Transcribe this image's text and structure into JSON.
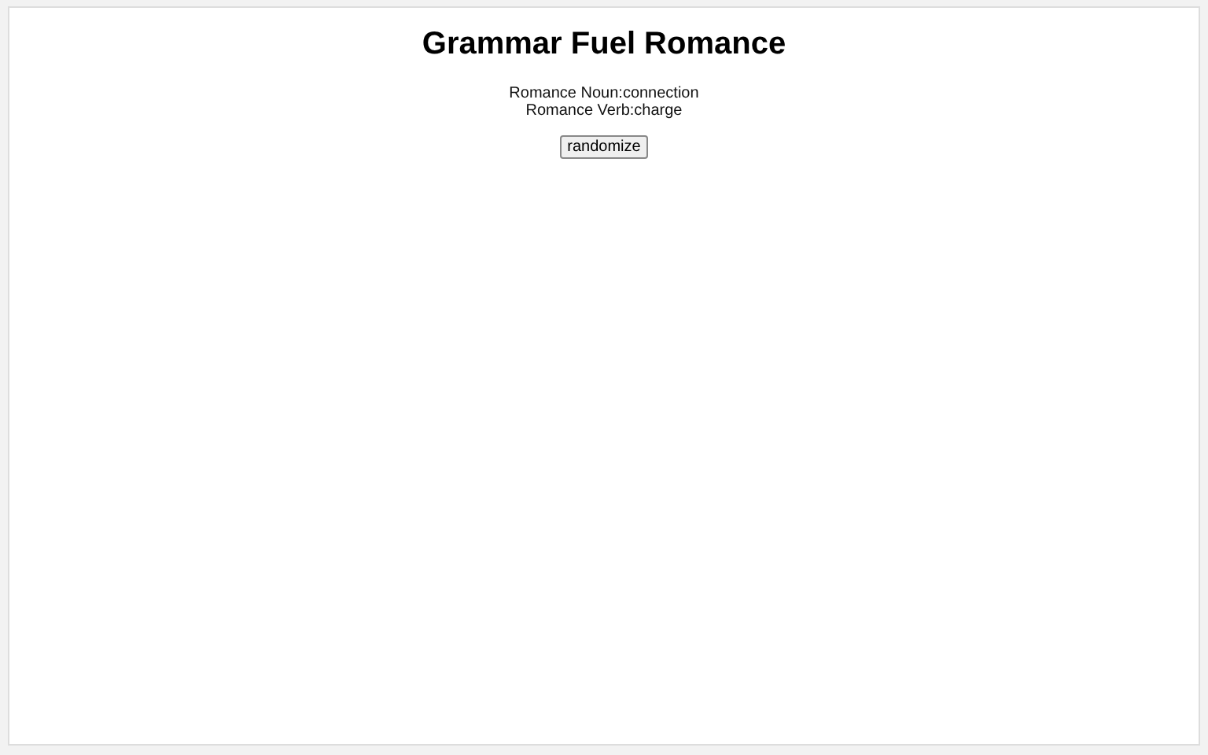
{
  "title": "Grammar Fuel Romance",
  "lines": [
    {
      "label": "Romance Noun:",
      "value": "connection"
    },
    {
      "label": "Romance Verb:",
      "value": "charge"
    }
  ],
  "button": "randomize"
}
